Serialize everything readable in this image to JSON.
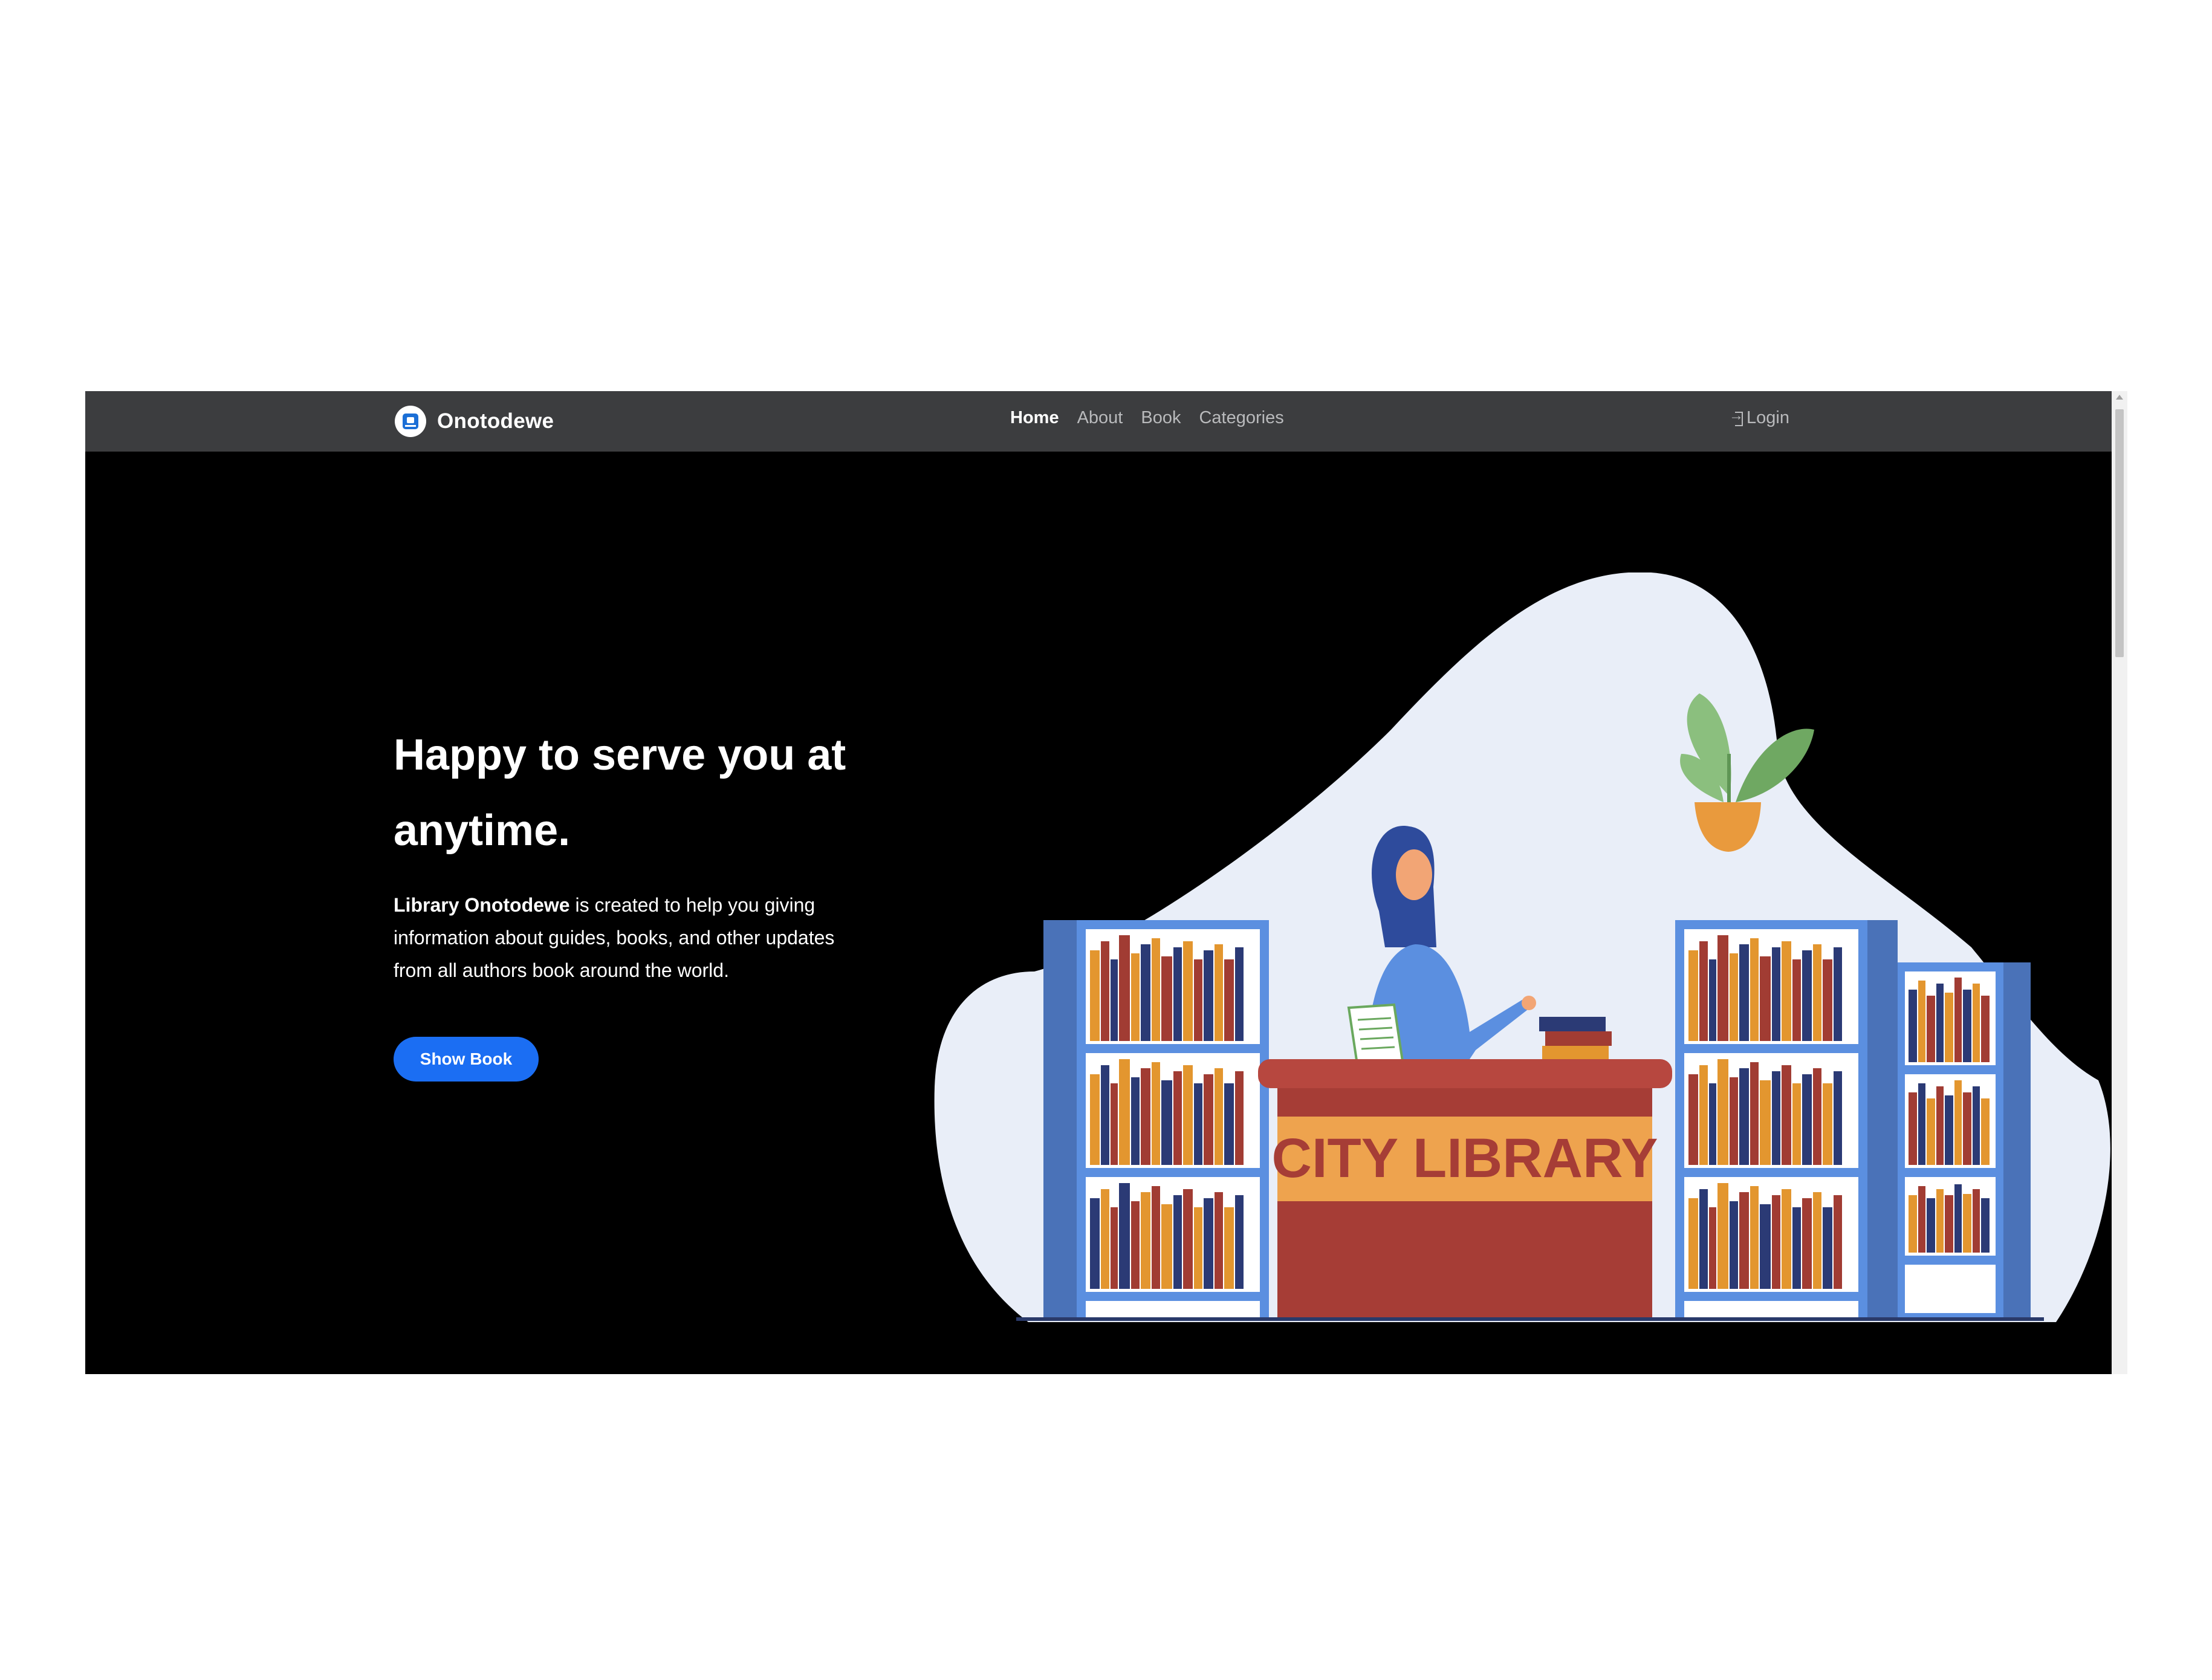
{
  "brand": {
    "name": "Onotodewe"
  },
  "nav": {
    "links": [
      {
        "label": "Home",
        "active": true
      },
      {
        "label": "About",
        "active": false
      },
      {
        "label": "Book",
        "active": false
      },
      {
        "label": "Categories",
        "active": false
      }
    ],
    "login": "Login"
  },
  "hero": {
    "title_line1": "Happy to serve you at",
    "title_line2": "anytime.",
    "desc_bold": "Library Onotodewe",
    "desc_rest": " is created to help you giving information about guides, books, and other updates from all authors book around the world.",
    "button": "Show Book"
  },
  "illustration": {
    "sign": "CITY LIBRARY"
  },
  "colors": {
    "navbar": "#3c3d3f",
    "hero_bg": "#000000",
    "button": "#1b6ef3",
    "blob": "#e9eef8",
    "shelf": "#5b8fe0",
    "desk": "#a63d36",
    "sign_bg": "#eea34e"
  }
}
